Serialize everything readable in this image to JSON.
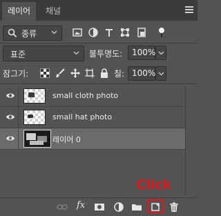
{
  "tabs": [
    {
      "label": "레이어",
      "active": true
    },
    {
      "label": "채널",
      "active": false
    }
  ],
  "filter": {
    "kind_label": "종류",
    "icons": [
      "image-filter-icon",
      "adjustment-filter-icon",
      "type-filter-icon",
      "shape-filter-icon",
      "smart-object-filter-icon",
      "filter-toggle-icon"
    ]
  },
  "blend": {
    "mode": "표준",
    "opacity_label": "불투명도:",
    "opacity_value": "100%"
  },
  "lock": {
    "label": "잠그기:",
    "fill_label": "칠:",
    "fill_value": "100%",
    "icons": [
      "lock-transparent-icon",
      "lock-brush-icon",
      "lock-move-icon",
      "lock-artboard-icon",
      "lock-all-icon"
    ]
  },
  "layers": [
    {
      "name": "small cloth photo",
      "visible": true,
      "selected": false,
      "thumb": "transparent"
    },
    {
      "name": "small hat photo",
      "visible": true,
      "selected": false,
      "thumb": "transparent"
    },
    {
      "name": "레이어 0",
      "visible": true,
      "selected": true,
      "thumb": "photo"
    }
  ],
  "bottom_icons": [
    "link-icon",
    "fx-icon",
    "mask-icon",
    "adjustment-layer-icon",
    "folder-icon",
    "new-layer-icon",
    "trash-icon"
  ],
  "annotation": {
    "text": "Click",
    "color": "#e0161b",
    "target": "new-layer-icon"
  },
  "colors": {
    "panel_bg": "#535353",
    "tabbar_bg": "#3b3b3b",
    "selected_row": "#6b6b6b",
    "annotation_red": "#e0161b"
  }
}
